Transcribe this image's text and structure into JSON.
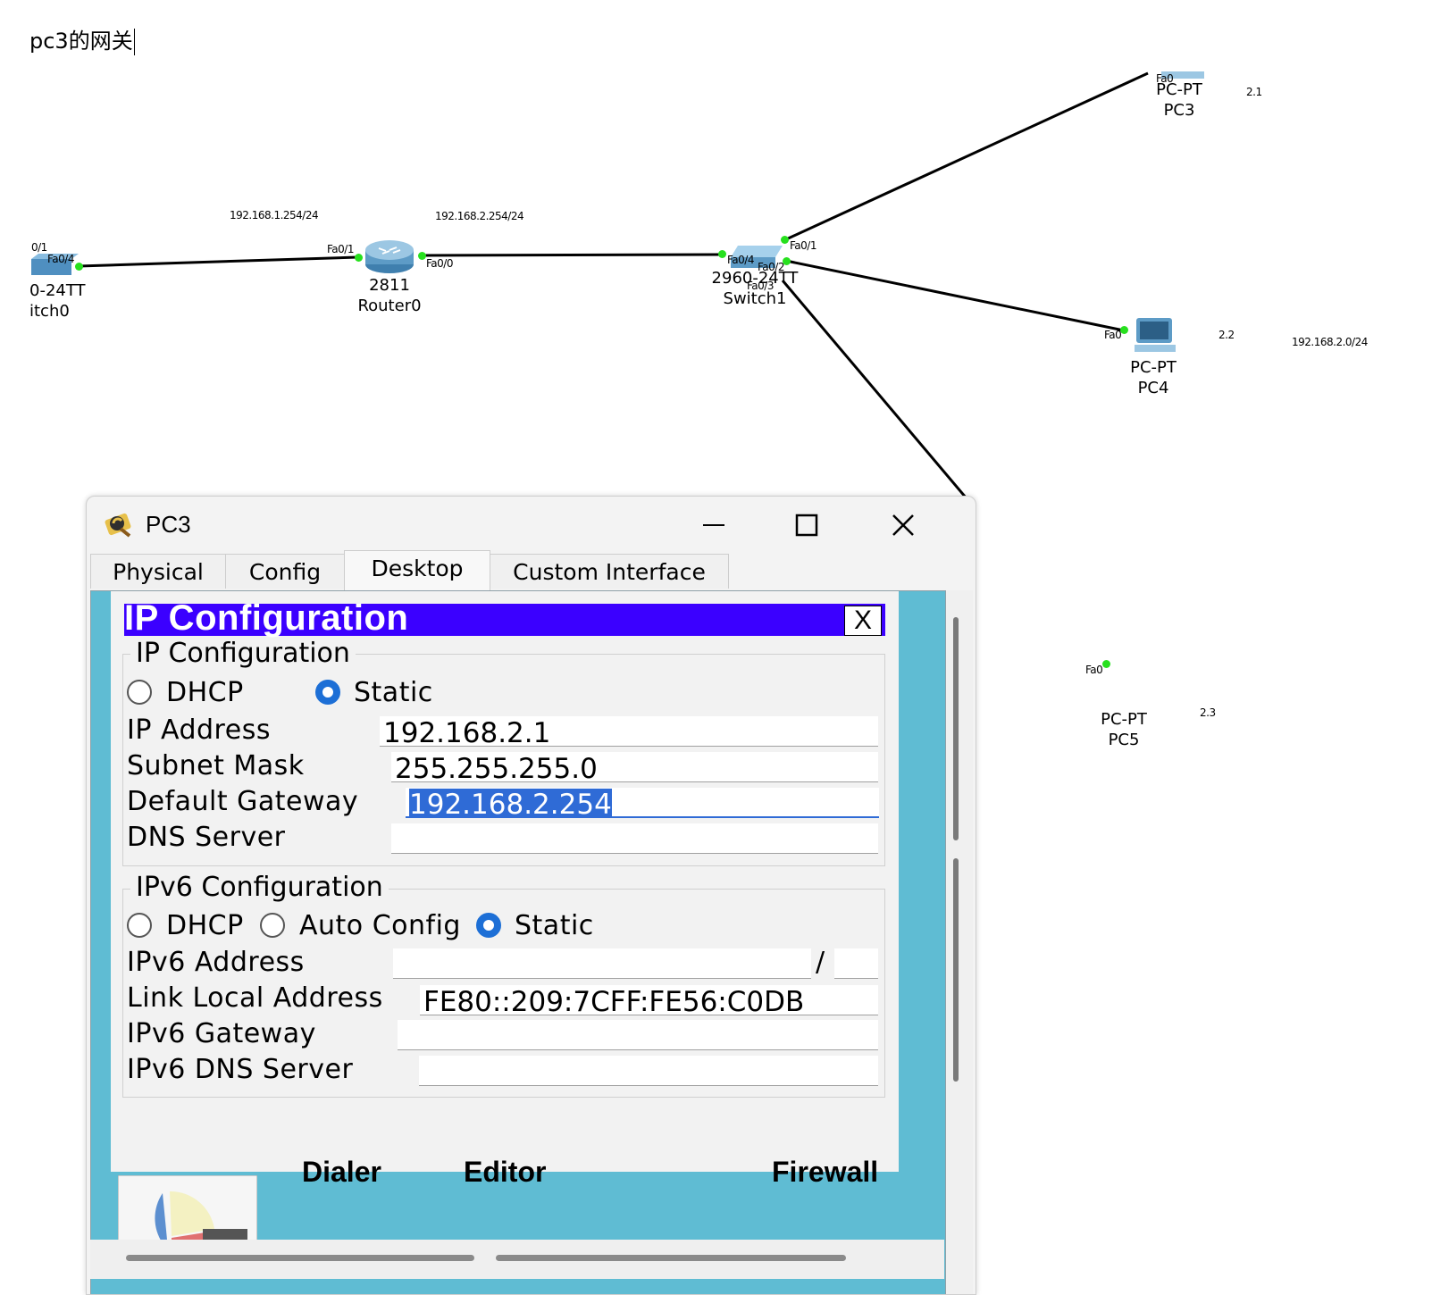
{
  "heading": "pc3的网关",
  "topology": {
    "net_labels": {
      "r0_left": "192.168.1.254/24",
      "r0_right": "192.168.2.254/24",
      "lan2": "192.168.2.0/24",
      "pc3_ip": "2.1",
      "pc4_ip": "2.2",
      "pc5_ip": "2.3"
    },
    "devices": {
      "switch0": {
        "model": "0-24TT",
        "name": "itch0",
        "port_a": "0/1",
        "port_b": "Fa0/4"
      },
      "router0": {
        "model": "2811",
        "name": "Router0",
        "port_left": "Fa0/1",
        "port_right": "Fa0/0"
      },
      "switch1": {
        "model": "2960-24TT",
        "name": "Switch1",
        "p1": "Fa0/1",
        "p2": "Fa0/2",
        "p3": "Fa0/3",
        "p4": "Fa0/4"
      },
      "pc3": {
        "model": "PC-PT",
        "name": "PC3",
        "port": "Fa0"
      },
      "pc4": {
        "model": "PC-PT",
        "name": "PC4",
        "port": "Fa0"
      },
      "pc5": {
        "model": "PC-PT",
        "name": "PC5",
        "port": "Fa0"
      }
    },
    "link_color": "#000000",
    "port_led_color": "#27e01e"
  },
  "window": {
    "title": "PC3",
    "tabs": [
      {
        "label": "Physical",
        "active": false
      },
      {
        "label": "Config",
        "active": false
      },
      {
        "label": "Desktop",
        "active": true
      },
      {
        "label": "Custom Interface",
        "active": false
      }
    ],
    "ipconfig": {
      "header": "IP Configuration",
      "close_label": "X",
      "ipv4": {
        "legend": "IP Configuration",
        "dhcp_label": "DHCP",
        "static_label": "Static",
        "mode": "Static",
        "ip_label": "IP Address",
        "ip_value": "192.168.2.1",
        "mask_label": "Subnet Mask",
        "mask_value": "255.255.255.0",
        "gw_label": "Default Gateway",
        "gw_value": "192.168.2.254",
        "dns_label": "DNS Server",
        "dns_value": ""
      },
      "ipv6": {
        "legend": "IPv6 Configuration",
        "dhcp_label": "DHCP",
        "auto_label": "Auto Config",
        "static_label": "Static",
        "mode": "Static",
        "addr_label": "IPv6 Address",
        "addr_value": "",
        "slash": "/",
        "prefix_value": "",
        "lla_label": "Link Local Address",
        "lla_value": "FE80::209:7CFF:FE56:C0DB",
        "gw_label": "IPv6 Gateway",
        "gw_value": "",
        "dns_label": "IPv6 DNS Server",
        "dns_value": ""
      },
      "accent": "#3b00ff"
    },
    "desktop_bg": "#5fbcd3",
    "dock_labels": [
      "Dialer",
      "Editor",
      "Firewall"
    ]
  }
}
